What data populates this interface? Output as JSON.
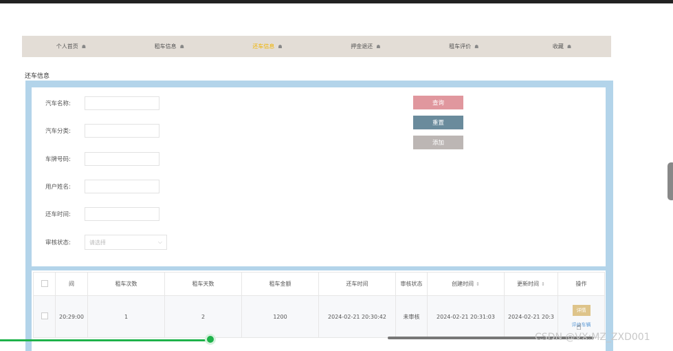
{
  "nav": {
    "items": [
      {
        "label": "个人首页"
      },
      {
        "label": "租车信息"
      },
      {
        "label": "还车信息"
      },
      {
        "label": "押金退还"
      },
      {
        "label": "租车评价"
      },
      {
        "label": "收藏"
      }
    ],
    "icon_glyph": "☗",
    "active_index": 2
  },
  "section_title": "还车信息",
  "form": {
    "car_name_label": "汽车名称:",
    "car_category_label": "汽车分类:",
    "plate_label": "车牌号码:",
    "user_name_label": "用户姓名:",
    "return_time_label": "还车时间:",
    "audit_label": "审核状态:",
    "audit_placeholder": "请选择"
  },
  "buttons": {
    "query": "查询",
    "reset": "重置",
    "add": "添加"
  },
  "table": {
    "headers": [
      "",
      "间",
      "租车次数",
      "租车天数",
      "租车金额",
      "还车时间",
      "审核状态",
      "创建时间",
      "更新时间",
      "操作"
    ],
    "rows": [
      {
        "time": "20:29:00",
        "rent_times": "1",
        "rent_days": "2",
        "amount": "1200",
        "return_time": "2024-02-21 20:30:42",
        "audit": "未审核",
        "created": "2024-02-21 20:31:03",
        "updated": "2024-02-21 20:3",
        "op_detail": "详情",
        "op_link": "评价车辆"
      }
    ]
  },
  "watermark": "CSDN @VX:MZ_ZXD001",
  "colors": {
    "nav_bg": "#e3ddd6",
    "nav_active": "#f0b400",
    "panel_border": "#b3d4ea",
    "query_btn": "#e0979e",
    "reset_btn": "#6a8b9c",
    "add_btn": "#bcb6b4",
    "detail_btn": "#dec48a",
    "progress": "#1eb24a"
  }
}
